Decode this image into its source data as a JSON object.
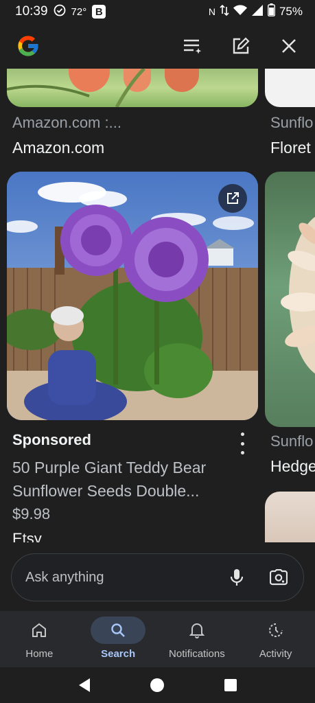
{
  "status": {
    "time": "10:39",
    "temp": "72°",
    "b_badge": "B",
    "net_letter": "N",
    "battery": "75%"
  },
  "feed": {
    "top_card": {
      "source_muted": "Amazon.com :...",
      "source_strong": "Amazon.com",
      "right_muted": "Sunflo",
      "right_strong": "Floret"
    },
    "main_card": {
      "sponsored_label": "Sponsored",
      "title": "50 Purple Giant Teddy Bear Sunflower Seeds Double...",
      "price": "$9.98",
      "seller": "Etsy",
      "right_muted": "Sunflo",
      "right_strong": "Hedge"
    }
  },
  "search": {
    "placeholder": "Ask anything"
  },
  "nav": {
    "items": [
      {
        "label": "Home",
        "icon": "home-icon"
      },
      {
        "label": "Search",
        "icon": "search-icon",
        "active": true
      },
      {
        "label": "Notifications",
        "icon": "bell-icon"
      },
      {
        "label": "Activity",
        "icon": "activity-icon"
      }
    ]
  },
  "colors": {
    "background": "#1f1f1f",
    "nav_bar": "#292a2d",
    "active_pill": "#394457",
    "active_text": "#a8c7fa"
  }
}
